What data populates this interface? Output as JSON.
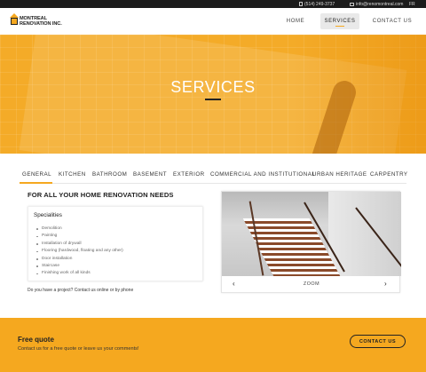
{
  "topbar": {
    "phone": "(514) 249-3737",
    "email": "info@renomontreal.com",
    "language": "FR"
  },
  "header": {
    "logo_line1": "MONTREAL",
    "logo_line2": "RENOVATION INC.",
    "nav": [
      {
        "label": "HOME"
      },
      {
        "label": "SERVICES",
        "active": true
      },
      {
        "label": "CONTACT US"
      }
    ]
  },
  "hero": {
    "title": "SERVICES"
  },
  "tabs": [
    {
      "label": "GENERAL",
      "active": true
    },
    {
      "label": "KITCHEN"
    },
    {
      "label": "BATHROOM"
    },
    {
      "label": "BASEMENT"
    },
    {
      "label": "EXTERIOR"
    },
    {
      "label": "COMMERCIAL AND INSTITUTIONAL"
    },
    {
      "label": "URBAN HERITAGE"
    },
    {
      "label": "CARPENTRY"
    }
  ],
  "main": {
    "heading": "FOR ALL YOUR HOME RENOVATION NEEDS",
    "specialities": {
      "title": "Specialities",
      "items": [
        "Demolition",
        "Painting",
        "Installation of drywall",
        "Flooring (hardwood, floating and any other)",
        "Door installation",
        "Staircase",
        "Finishing work of all kinds"
      ]
    },
    "question": "Do you have a project? Contact us online or by phone",
    "gallery": {
      "caption": "ZOOM",
      "prev_icon": "‹",
      "next_icon": "›"
    }
  },
  "footer": {
    "title": "Free quote",
    "text": "Contact us for a free quote or leave us your comments!",
    "button": "CONTACT US"
  },
  "colors": {
    "accent": "#f5a81f",
    "topbar": "#1c1c1c"
  }
}
